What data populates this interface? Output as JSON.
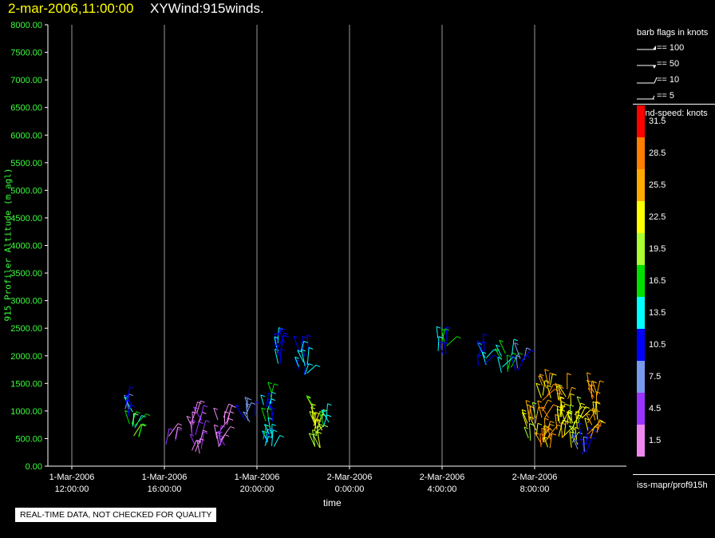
{
  "header": {
    "date_time": "2-mar-2006,11:00:00",
    "title": "XYWind:915winds."
  },
  "chart_data": {
    "type": "scatter",
    "ylabel": "915 Profiler Altitude (m agl)",
    "xlabel": "time",
    "ylim": [
      0,
      8000
    ],
    "y_ticks": [
      "0.00",
      "500.00",
      "1000.00",
      "1500.00",
      "2000.00",
      "2500.00",
      "3000.00",
      "3500.00",
      "4000.00",
      "4500.00",
      "5000.00",
      "5500.00",
      "6000.00",
      "6500.00",
      "7000.00",
      "7500.00",
      "8000.00"
    ],
    "x_ticks": [
      {
        "date": "1-Mar-2006",
        "time": "12:00:00"
      },
      {
        "date": "1-Mar-2006",
        "time": "16:00:00"
      },
      {
        "date": "1-Mar-2006",
        "time": "20:00:00"
      },
      {
        "date": "2-Mar-2006",
        "time": "0:00:00"
      },
      {
        "date": "2-Mar-2006",
        "time": "4:00:00"
      },
      {
        "date": "2-Mar-2006",
        "time": "8:00:00"
      }
    ],
    "xlim_hours": [
      11,
      24
    ],
    "grid": "vertical lines at time ticks",
    "wind_clusters": [
      {
        "time_h": 14.7,
        "alt_min": 500,
        "alt_max": 900,
        "speed": 17
      },
      {
        "time_h": 14.5,
        "alt_min": 900,
        "alt_max": 1200,
        "speed": 10
      },
      {
        "time_h": 16.3,
        "alt_min": 380,
        "alt_max": 560,
        "speed": 4
      },
      {
        "time_h": 17.4,
        "alt_min": 220,
        "alt_max": 1000,
        "speed": 3
      },
      {
        "time_h": 18.5,
        "alt_min": 300,
        "alt_max": 900,
        "speed": 3
      },
      {
        "time_h": 19.7,
        "alt_min": 800,
        "alt_max": 1100,
        "speed": 8
      },
      {
        "time_h": 20.5,
        "alt_min": 350,
        "alt_max": 1350,
        "speed": 14
      },
      {
        "time_h": 21.0,
        "alt_min": 1800,
        "alt_max": 2250,
        "speed": 12
      },
      {
        "time_h": 22.0,
        "alt_min": 1600,
        "alt_max": 2200,
        "speed": 12
      },
      {
        "time_h": 22.6,
        "alt_min": 250,
        "alt_max": 1100,
        "speed": 20
      },
      {
        "time_h": 23.0,
        "alt_min": 700,
        "alt_max": 900,
        "speed": 16
      },
      {
        "time_h": 28.0,
        "alt_min": 2000,
        "alt_max": 2350,
        "speed": 13
      },
      {
        "time_h": 29.7,
        "alt_min": 1800,
        "alt_max": 2150,
        "speed": 12
      },
      {
        "time_h": 30.8,
        "alt_min": 1650,
        "alt_max": 2050,
        "speed": 15
      },
      {
        "time_h": 31.4,
        "alt_min": 1700,
        "alt_max": 1950,
        "speed": 9
      },
      {
        "time_h": 31.9,
        "alt_min": 450,
        "alt_max": 1000,
        "speed": 23
      },
      {
        "time_h": 32.5,
        "alt_min": 300,
        "alt_max": 1500,
        "speed": 26
      },
      {
        "time_h": 33.2,
        "alt_min": 400,
        "alt_max": 1400,
        "speed": 24
      },
      {
        "time_h": 33.8,
        "alt_min": 300,
        "alt_max": 1100,
        "speed": 21
      },
      {
        "time_h": 34.1,
        "alt_min": 200,
        "alt_max": 600,
        "speed": 9
      },
      {
        "time_h": 34.5,
        "alt_min": 500,
        "alt_max": 1400,
        "speed": 25
      }
    ]
  },
  "legend": {
    "barb_title": "barb flags in knots",
    "barbs": [
      {
        "label": "== 100"
      },
      {
        "label": "== 50"
      },
      {
        "label": "== 10"
      },
      {
        "label": "== 5"
      }
    ],
    "speed_title": "wind-speed: knots",
    "scale": [
      {
        "label": "31.5",
        "color": "#ff0000"
      },
      {
        "label": "28.5",
        "color": "#ff7f00"
      },
      {
        "label": "25.5",
        "color": "#ffaa00"
      },
      {
        "label": "22.5",
        "color": "#ffff00"
      },
      {
        "label": "19.5",
        "color": "#aaff33"
      },
      {
        "label": "16.5",
        "color": "#00e000"
      },
      {
        "label": "13.5",
        "color": "#00ffff"
      },
      {
        "label": "10.5",
        "color": "#0000ff"
      },
      {
        "label": "7.5",
        "color": "#7799ee"
      },
      {
        "label": "4.5",
        "color": "#9933ff"
      },
      {
        "label": "1.5",
        "color": "#ee88ee"
      }
    ],
    "source": "iss-mapr/prof915h"
  },
  "footer": {
    "qc_note": "REAL-TIME DATA, NOT CHECKED FOR QUALITY"
  }
}
